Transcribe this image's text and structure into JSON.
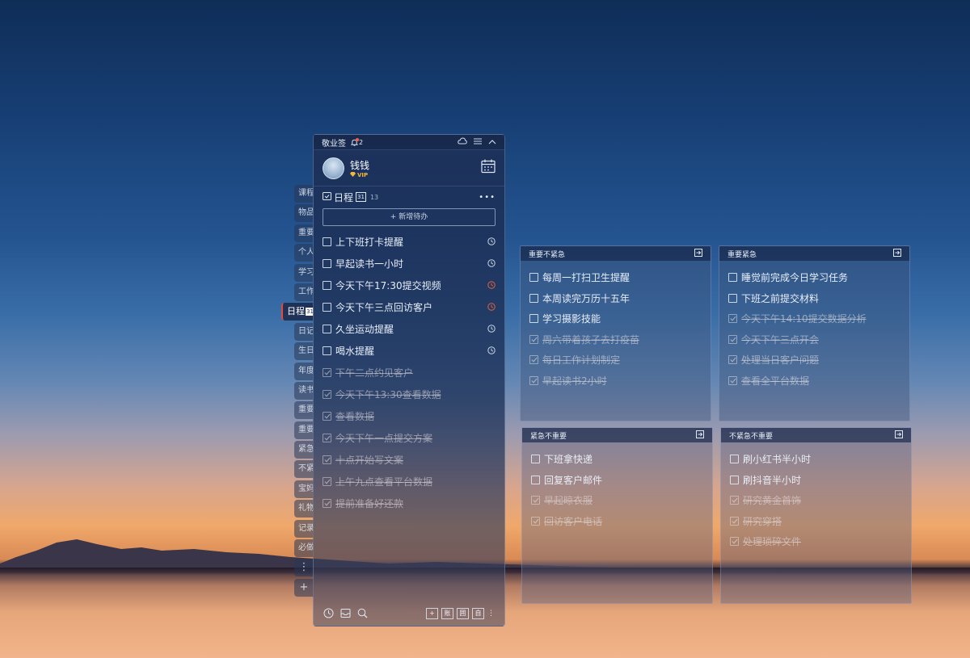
{
  "app": {
    "title": "敬业签",
    "notif_count": "2"
  },
  "user": {
    "name": "钱钱",
    "badge": "VIP"
  },
  "side_tabs": [
    {
      "label": "课程"
    },
    {
      "label": "物品"
    },
    {
      "label": "重要"
    },
    {
      "label": "个人"
    },
    {
      "label": "学习"
    },
    {
      "label": "工作"
    },
    {
      "label": "日程",
      "active": true
    },
    {
      "label": "日记"
    },
    {
      "label": "生日"
    },
    {
      "label": "年度"
    },
    {
      "label": "读书"
    },
    {
      "label": "重要"
    },
    {
      "label": "重要"
    },
    {
      "label": "紧急"
    },
    {
      "label": "不紧"
    },
    {
      "label": "宝妈"
    },
    {
      "label": "礼物"
    },
    {
      "label": "记录"
    },
    {
      "label": "必做"
    }
  ],
  "side_more": "⋮",
  "side_add": "+",
  "schedule": {
    "title": "日程",
    "cal_icon_text": "31",
    "count": "13",
    "more": "•••",
    "new_todo": "+ 新增待办",
    "items": [
      {
        "text": "上下班打卡提醒",
        "done": false,
        "clock": true
      },
      {
        "text": "早起读书一小时",
        "done": false,
        "clock": true
      },
      {
        "text": "今天下午17:30提交视频",
        "done": false,
        "clock": true,
        "clock_color": "#e0623c"
      },
      {
        "text": "今天下午三点回访客户",
        "done": false,
        "clock": true,
        "clock_color": "#e0623c"
      },
      {
        "text": "久坐运动提醒",
        "done": false,
        "clock": true
      },
      {
        "text": "喝水提醒",
        "done": false,
        "clock": true
      },
      {
        "text": "下午二点约见客户",
        "done": true
      },
      {
        "text": "今天下午13:30查看数据",
        "done": true
      },
      {
        "text": "查看数据",
        "done": true
      },
      {
        "text": "今天下午一点提交方案",
        "done": true
      },
      {
        "text": "十点开始写文案",
        "done": true
      },
      {
        "text": "上午九点查看平台数据",
        "done": true
      },
      {
        "text": "提前准备好还款",
        "done": true
      }
    ]
  },
  "footer": {
    "btn_account": "账",
    "btn_table": "囲",
    "btn_self": "自"
  },
  "quadrants": [
    {
      "title": "重要不紧急",
      "items": [
        {
          "text": "每周一打扫卫生提醒",
          "done": false
        },
        {
          "text": "本周读完万历十五年",
          "done": false
        },
        {
          "text": "学习摄影技能",
          "done": false
        },
        {
          "text": "周六带着孩子去打疫苗",
          "done": true
        },
        {
          "text": "每日工作计划制定",
          "done": true
        },
        {
          "text": "早起读书2小时",
          "done": true
        }
      ]
    },
    {
      "title": "重要紧急",
      "items": [
        {
          "text": "睡觉前完成今日学习任务",
          "done": false
        },
        {
          "text": "下班之前提交材料",
          "done": false
        },
        {
          "text": "今天下午14:10提交数据分析",
          "done": true
        },
        {
          "text": "今天下午三点开会",
          "done": true
        },
        {
          "text": "处理当日客户问题",
          "done": true
        },
        {
          "text": "查看全平台数据",
          "done": true
        }
      ]
    },
    {
      "title": "紧急不重要",
      "items": [
        {
          "text": "下班拿快递",
          "done": false
        },
        {
          "text": "回复客户邮件",
          "done": false
        },
        {
          "text": "早起晾衣服",
          "done": true
        },
        {
          "text": "回访客户电话",
          "done": true
        }
      ]
    },
    {
      "title": "不紧急不重要",
      "items": [
        {
          "text": "刷小红书半小时",
          "done": false
        },
        {
          "text": "刷抖音半小时",
          "done": false
        },
        {
          "text": "研究黄金首饰",
          "done": true
        },
        {
          "text": "研究穿搭",
          "done": true
        },
        {
          "text": "处理琐碎文件",
          "done": true
        }
      ]
    }
  ],
  "colors": {
    "accent_red": "#e24a3a",
    "vip_gold": "#f5b93a",
    "alert_clock": "#e0623c"
  }
}
